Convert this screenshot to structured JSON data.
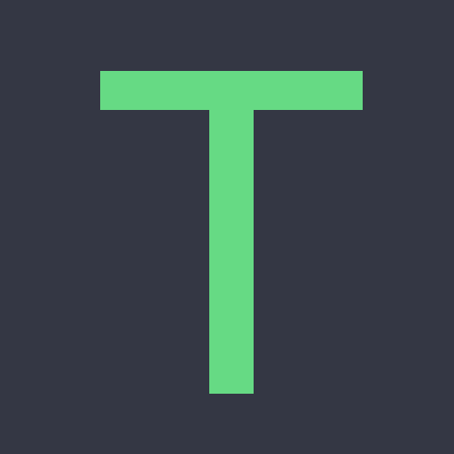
{
  "logo": {
    "letter": "T",
    "background_color": "#343744",
    "letter_color": "#66DA84"
  }
}
